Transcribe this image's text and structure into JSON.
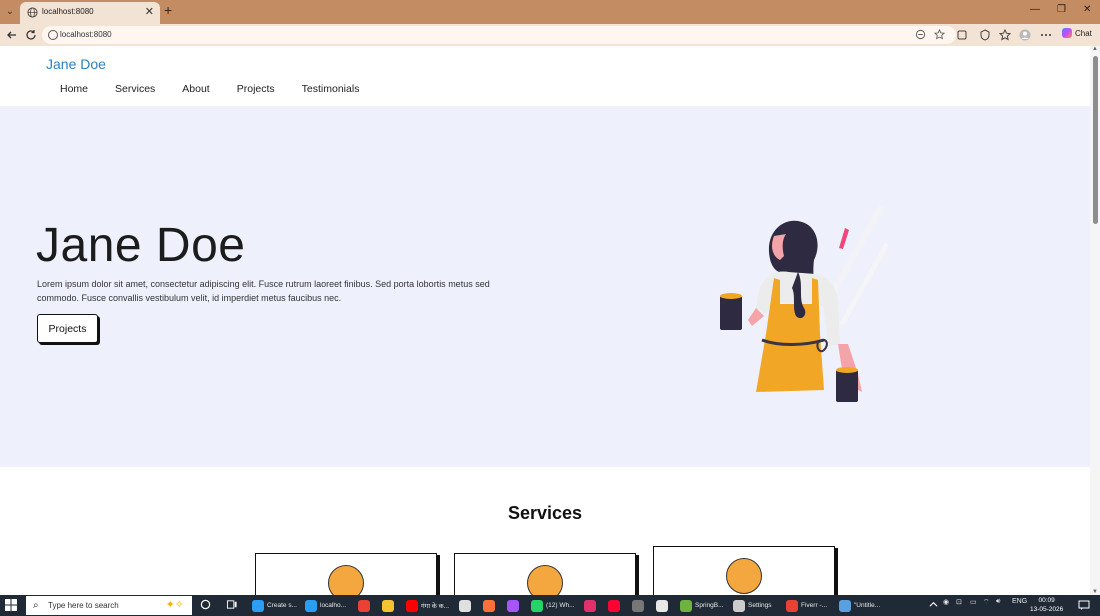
{
  "browser": {
    "tab_title": "localhost:8080",
    "tab_close": "✕",
    "new_tab": "+",
    "win_min": "—",
    "win_max": "❐",
    "win_close": "✕",
    "url": "localhost:8080",
    "chat_label": "Chat"
  },
  "header": {
    "brand": "Jane Doe",
    "nav": [
      "Home",
      "Services",
      "About",
      "Projects",
      "Testimonials"
    ]
  },
  "hero": {
    "title": "Jane Doe",
    "text": "Lorem ipsum dolor sit amet, consectetur adipiscing elit. Fusce rutrum laoreet finibus. Sed porta lobortis metus sed commodo. Fusce convallis vestibulum velit, id imperdiet metus faucibus nec.",
    "button": "Projects"
  },
  "services": {
    "title": "Services",
    "card_count_visible": 3
  },
  "colors": {
    "brand": "#2a82c4",
    "hero_bg": "#eef0fb",
    "accent_orange": "#f3a73e",
    "apron": "#f2a626"
  },
  "taskbar": {
    "search_placeholder": "Type here to search",
    "apps": [
      {
        "label": "Create s...",
        "color": "#2a9df4"
      },
      {
        "label": "localho...",
        "color": "#2a9df4"
      },
      {
        "label": "",
        "color": "#e94235"
      },
      {
        "label": "",
        "color": "#f4c430"
      },
      {
        "label": "गंगा के क...",
        "color": "#ff0000"
      },
      {
        "label": "",
        "color": "#e0e0e0"
      },
      {
        "label": "",
        "color": "#ff7139"
      },
      {
        "label": "",
        "color": "#a855f7"
      },
      {
        "label": "(12) Wh...",
        "color": "#25d366"
      },
      {
        "label": "",
        "color": "#e1306c"
      },
      {
        "label": "",
        "color": "#ff0033"
      },
      {
        "label": "",
        "color": "#777"
      },
      {
        "label": "",
        "color": "#e8e8e8"
      },
      {
        "label": "SpringB...",
        "color": "#6db33f"
      },
      {
        "label": "Settings",
        "color": "#cccccc"
      },
      {
        "label": "Fiverr -...",
        "color": "#e94235"
      },
      {
        "label": "\"Untitle...",
        "color": "#5aa0e0"
      }
    ],
    "tray_lang": "ENG",
    "time": "00:09",
    "date": "13-05-2026"
  }
}
